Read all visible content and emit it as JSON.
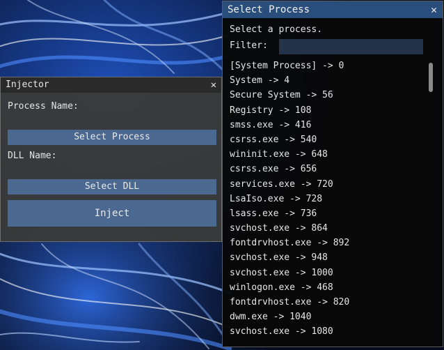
{
  "injector": {
    "title": "Injector",
    "close_glyph": "✕",
    "process_name_label": "Process Name:",
    "select_process_label": "Select Process",
    "dll_name_label": "DLL Name:",
    "select_dll_label": "Select DLL",
    "inject_label": "Inject"
  },
  "select_process": {
    "title": "Select Process",
    "close_glyph": "✕",
    "prompt": "Select a process.",
    "filter_label": "Filter:",
    "filter_value": "",
    "processes": [
      "[System Process] -> 0",
      "System -> 4",
      "Secure System -> 56",
      "Registry -> 108",
      "smss.exe -> 416",
      "csrss.exe -> 540",
      "wininit.exe -> 648",
      "csrss.exe -> 656",
      "services.exe -> 720",
      "LsaIso.exe -> 728",
      "lsass.exe -> 736",
      "svchost.exe -> 864",
      "fontdrvhost.exe -> 892",
      "svchost.exe -> 948",
      "svchost.exe -> 1000",
      "winlogon.exe -> 468",
      "fontdrvhost.exe -> 820",
      "dwm.exe -> 1040",
      "svchost.exe -> 1080"
    ]
  },
  "colors": {
    "button": "#4a6890",
    "title_active": "#2a4e7c",
    "filter_bg": "#23334a",
    "wallpaper_accent": "#2f6fe0"
  }
}
